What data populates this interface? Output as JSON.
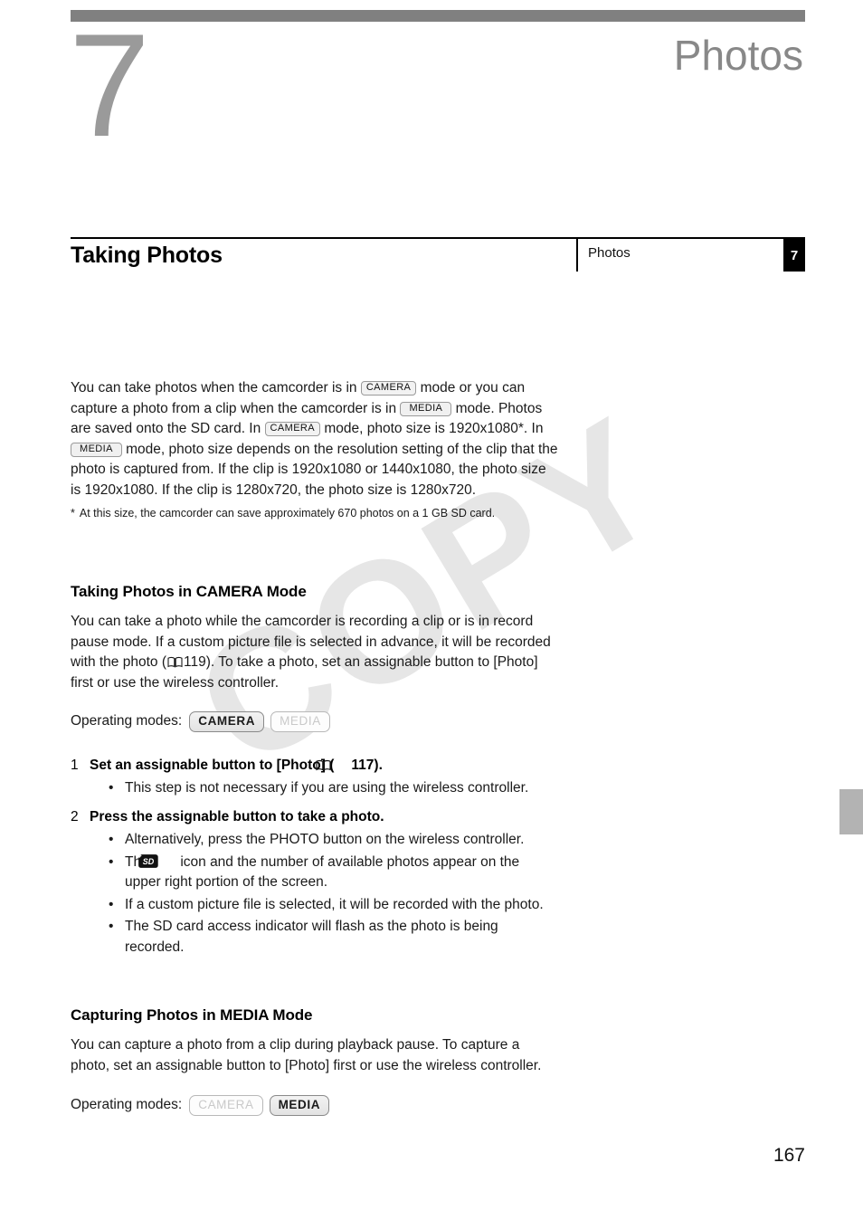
{
  "chapter": {
    "number": "7",
    "title": "Photos"
  },
  "running_head": {
    "section_title": "Taking Photos",
    "box_label": "Photos",
    "box_number": "7"
  },
  "watermark": {
    "text": "COPY"
  },
  "intro": {
    "t1": "You can take photos when the camcorder is in ",
    "pill1": "CAMERA",
    "t2": " mode or you can capture a photo from a clip when the camcorder is in ",
    "pill2": "MEDIA",
    "t3": " mode. Photos are saved onto the SD card. In ",
    "pill3": "CAMERA",
    "t4": " mode, photo size is 1920x1080*. In ",
    "pill4": "MEDIA",
    "t5": " mode, photo size depends on the resolution setting of the clip that the photo is captured from. If the clip is 1920x1080 or 1440x1080, the photo size is 1920x1080. If the clip is 1280x720, the photo size is 1280x720.",
    "footnote_marker": "*",
    "footnote": "At this size, the camcorder can save approximately 670 photos on a 1 GB SD card."
  },
  "section_camera": {
    "heading": "Taking Photos in CAMERA Mode",
    "p1_a": "You can take a photo while the camcorder is recording a clip or is in record pause mode. If a custom picture file is selected in advance, it will be recorded with the photo (",
    "p1_page": "119",
    "p1_b": "). To take a photo, set an assignable button to [Photo] first or use the wireless controller.",
    "operating_modes_label": "Operating modes:",
    "modes": [
      {
        "name": "CAMERA",
        "active": true
      },
      {
        "name": "MEDIA",
        "active": false
      }
    ],
    "steps": [
      {
        "num": "1",
        "text_a": "Set an assignable button to [Photo] (",
        "page_ref": "117",
        "text_b": ").",
        "bullets": [
          {
            "text": "This step is not necessary if you are using the wireless controller."
          }
        ]
      },
      {
        "num": "2",
        "text_a": "Press the assignable button to take a photo.",
        "page_ref": "",
        "text_b": "",
        "bullets": [
          {
            "text": "Alternatively, press the PHOTO button on the wireless controller."
          },
          {
            "text_a": "The ",
            "icon": "sd-card-icon",
            "text_b": " icon and the number of available photos appear on the upper right portion of the screen."
          },
          {
            "text": "If a custom picture file is selected, it will be recorded with the photo."
          },
          {
            "text": "The SD card access indicator will flash as the photo is being recorded."
          }
        ]
      }
    ]
  },
  "section_media": {
    "heading": "Capturing Photos in MEDIA Mode",
    "p1": "You can capture a photo from a clip during playback pause. To capture a photo, set an assignable button to [Photo] first or use the wireless controller.",
    "operating_modes_label": "Operating modes:",
    "modes": [
      {
        "name": "CAMERA",
        "active": false
      },
      {
        "name": "MEDIA",
        "active": true
      }
    ]
  },
  "footer": {
    "page_number": "167"
  },
  "colors": {
    "chapter_bar": "#808080",
    "chapter_number": "#9a9a9a",
    "chapter_title": "#888888",
    "side_tab": "#b3b3b3",
    "watermark": "#e6e6e6",
    "head_box_number_bg": "#000000"
  }
}
